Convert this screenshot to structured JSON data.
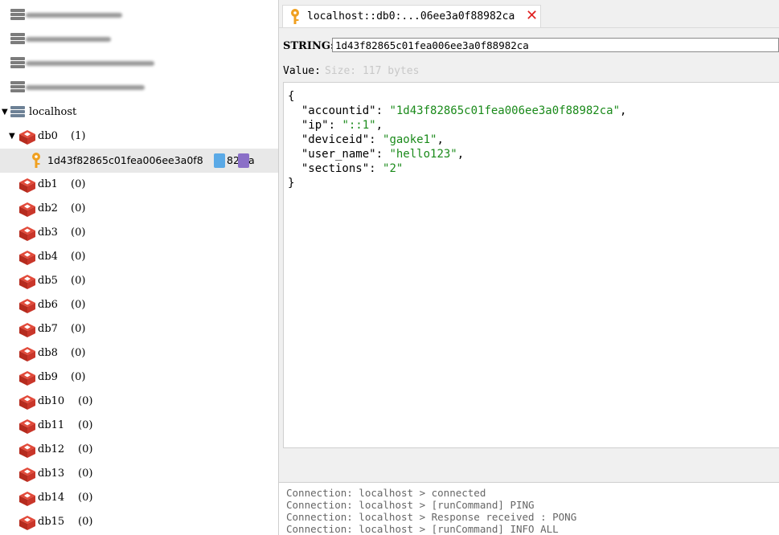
{
  "tree": {
    "hidden_servers": [
      {
        "blur_widths": 120
      },
      {
        "blur_widths": 106
      },
      {
        "blur_widths": 160
      },
      {
        "blur_widths": 148
      }
    ],
    "connection": {
      "label": "localhost"
    },
    "databases": [
      {
        "name": "db0",
        "count": "(1)",
        "expanded": true
      },
      {
        "name": "db1",
        "count": "(0)"
      },
      {
        "name": "db2",
        "count": "(0)"
      },
      {
        "name": "db3",
        "count": "(0)"
      },
      {
        "name": "db4",
        "count": "(0)"
      },
      {
        "name": "db5",
        "count": "(0)"
      },
      {
        "name": "db6",
        "count": "(0)"
      },
      {
        "name": "db7",
        "count": "(0)"
      },
      {
        "name": "db8",
        "count": "(0)"
      },
      {
        "name": "db9",
        "count": "(0)"
      },
      {
        "name": "db10",
        "count": "(0)"
      },
      {
        "name": "db11",
        "count": "(0)"
      },
      {
        "name": "db12",
        "count": "(0)"
      },
      {
        "name": "db13",
        "count": "(0)"
      },
      {
        "name": "db14",
        "count": "(0)"
      },
      {
        "name": "db15",
        "count": "(0)"
      }
    ],
    "selected_key": {
      "label": "1d43f82865c01fea006ee3a0f8",
      "tail": "82",
      "end": "a"
    }
  },
  "tab": {
    "title": "localhost::db0:...06ee3a0f88982ca",
    "close": "✕"
  },
  "editor": {
    "type_label": "STRING:",
    "key_value": "1d43f82865c01fea006ee3a0f88982ca",
    "value_label": "Value:",
    "size_label": "Size: 117 bytes",
    "lines": [
      {
        "pre": "{"
      },
      {
        "pre": "  \"accountid\": ",
        "str": "\"1d43f82865c01fea006ee3a0f88982ca\"",
        "post": ","
      },
      {
        "pre": "  \"ip\": ",
        "str": "\"::1\"",
        "post": ","
      },
      {
        "pre": "  \"deviceid\": ",
        "str": "\"gaoke1\"",
        "post": ","
      },
      {
        "pre": "  \"user_name\": ",
        "str": "\"hello123\"",
        "post": ","
      },
      {
        "pre": "  \"sections\": ",
        "str": "\"2\"",
        "post": ""
      },
      {
        "pre": "}"
      }
    ]
  },
  "log": [
    "Connection: localhost > connected",
    "Connection: localhost > [runCommand] PING",
    "Connection: localhost > Response received : PONG",
    "Connection: localhost > [runCommand] INFO ALL"
  ],
  "colors": {
    "accent_red": "#e02020",
    "json_string": "#1a8a1a",
    "key_icon": "#f0a020",
    "db_icon": "#d03a2a"
  }
}
